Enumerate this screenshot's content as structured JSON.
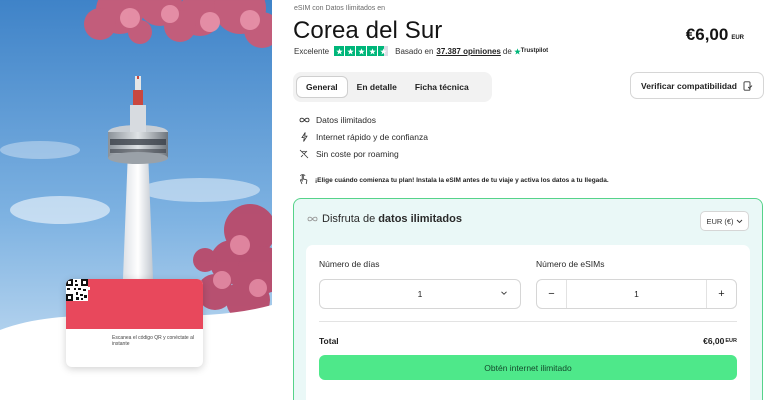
{
  "hero": {
    "card": {
      "text": "Escanea el código QR y conéctate al instante"
    }
  },
  "product": {
    "supertitle": "eSIM con Datos Ilimitados en",
    "title": "Corea del Sur",
    "price": "€6,00",
    "price_currency": "EUR"
  },
  "rating": {
    "label": "Excelente",
    "stars": 4.5,
    "based_on": "Basado en",
    "reviews_link": "37.387 opiniones",
    "of": "de",
    "provider": "Trustpilot",
    "colors": {
      "star_green": "#00b67a"
    }
  },
  "tabs": [
    {
      "label": "General",
      "active": true
    },
    {
      "label": "En detalle",
      "active": false
    },
    {
      "label": "Ficha técnica",
      "active": false
    }
  ],
  "verify_button": {
    "label": "Verificar compatibilidad",
    "icon": "phone-check-icon"
  },
  "features": [
    {
      "icon": "infinity-icon",
      "label": "Datos ilimitados"
    },
    {
      "icon": "lightning-icon",
      "label": "Internet rápido y de confianza"
    },
    {
      "icon": "no-roaming-icon",
      "label": "Sin coste por roaming"
    }
  ],
  "hint": {
    "icon": "hand-tap-icon",
    "text": "¡Elige cuándo comienza tu plan! Instala la eSIM antes de tu viaje y activa los datos a tu llegada."
  },
  "panel": {
    "title_prefix": "Disfruta de",
    "title_bold": "datos ilimitados",
    "currency_select": "EUR (€)",
    "days_label": "Número de días",
    "days_value": "1",
    "esims_label": "Número de eSIMs",
    "esims_value": "1",
    "minus": "−",
    "plus": "+",
    "total_label": "Total",
    "total_value": "€6,00",
    "total_currency": "EUR",
    "cta_label": "Obtén internet ilimitado",
    "colors": {
      "border": "#56d38a",
      "background": "#eaf8f7",
      "cta": "#4ee88a"
    }
  }
}
